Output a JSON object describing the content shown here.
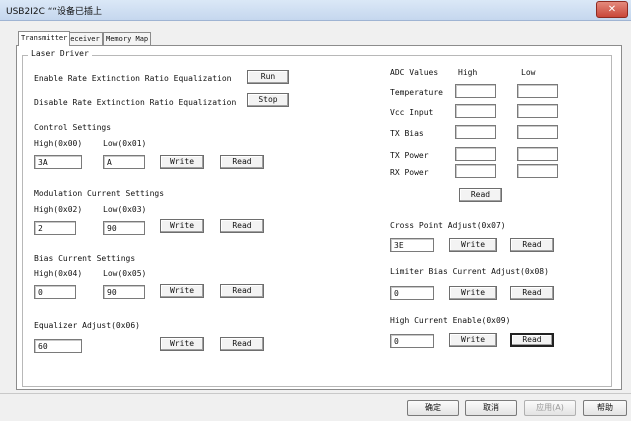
{
  "window": {
    "title": "USB2I2C ““设备已插上",
    "close_glyph": "✕"
  },
  "tabs": [
    {
      "label": "Transmitter"
    },
    {
      "label": "Receiver"
    },
    {
      "label": "Memory Map"
    }
  ],
  "group_label": "Laser Driver",
  "left": {
    "enable_label": "Enable Rate Extinction Ratio Equalization",
    "run_button": "Run",
    "disable_label": "Disable Rate Extinction Ratio Equalization",
    "stop_button": "Stop",
    "control": {
      "title": "Control Settings",
      "high_label": "High(0x00)",
      "low_label": "Low(0x01)",
      "high_value": "3A",
      "low_value": "A",
      "write": "Write",
      "read": "Read"
    },
    "modulation": {
      "title": "Modulation Current Settings",
      "high_label": "High(0x02)",
      "low_label": "Low(0x03)",
      "high_value": "2",
      "low_value": "90",
      "write": "Write",
      "read": "Read"
    },
    "bias": {
      "title": "Bias Current Settings",
      "high_label": "High(0x04)",
      "low_label": "Low(0x05)",
      "high_value": "0",
      "low_value": "90",
      "write": "Write",
      "read": "Read"
    },
    "equalizer": {
      "title": "Equalizer Adjust(0x06)",
      "value": "60",
      "write": "Write",
      "read": "Read"
    }
  },
  "right": {
    "adc_label": "ADC Values",
    "high_header": "High",
    "low_header": "Low",
    "rows": [
      {
        "label": "Temperature"
      },
      {
        "label": "Vcc Input"
      },
      {
        "label": "TX Bias"
      },
      {
        "label": "TX Power"
      },
      {
        "label": "RX Power"
      }
    ],
    "adc_read": "Read",
    "cross": {
      "label": "Cross Point Adjust(0x07)",
      "value": "3E",
      "write": "Write",
      "read": "Read"
    },
    "limiter": {
      "label": "Limiter Bias Current Adjust(0x08)",
      "value": "0",
      "write": "Write",
      "read": "Read"
    },
    "high_current": {
      "label": "High Current Enable(0x09)",
      "value": "0",
      "write": "Write",
      "read": "Read"
    }
  },
  "dialog_buttons": {
    "ok": "确定",
    "cancel": "取消",
    "apply": "应用(A)",
    "help": "帮助"
  }
}
